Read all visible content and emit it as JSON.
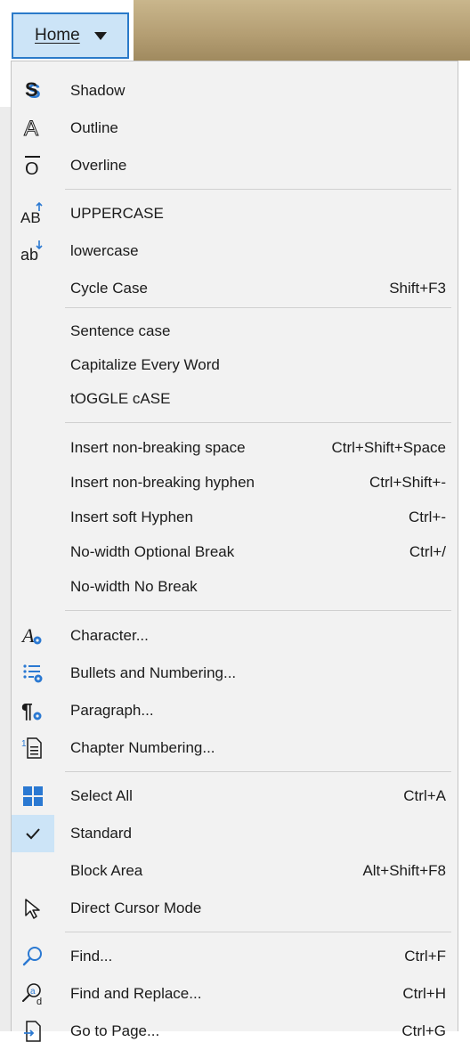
{
  "toolbar": {
    "home_label": "Home"
  },
  "menu": {
    "items": [
      {
        "label": "Shadow",
        "shortcut": "",
        "icon": "shadow-icon"
      },
      {
        "label": "Outline",
        "shortcut": "",
        "icon": "outline-icon"
      },
      {
        "label": "Overline",
        "shortcut": "",
        "icon": "overline-icon"
      },
      {
        "label": "UPPERCASE",
        "shortcut": "",
        "icon": "uppercase-icon"
      },
      {
        "label": "lowercase",
        "shortcut": "",
        "icon": "lowercase-icon"
      },
      {
        "label": "Cycle Case",
        "shortcut": "Shift+F3",
        "icon": ""
      },
      {
        "label": "Sentence case",
        "shortcut": "",
        "icon": ""
      },
      {
        "label": "Capitalize Every Word",
        "shortcut": "",
        "icon": ""
      },
      {
        "label": "tOGGLE cASE",
        "shortcut": "",
        "icon": ""
      },
      {
        "label": "Insert non-breaking space",
        "shortcut": "Ctrl+Shift+Space",
        "icon": ""
      },
      {
        "label": "Insert non-breaking hyphen",
        "shortcut": "Ctrl+Shift+-",
        "icon": ""
      },
      {
        "label": "Insert soft Hyphen",
        "shortcut": "Ctrl+-",
        "icon": ""
      },
      {
        "label": "No-width Optional Break",
        "shortcut": "Ctrl+/",
        "icon": ""
      },
      {
        "label": "No-width No Break",
        "shortcut": "",
        "icon": ""
      },
      {
        "label": "Character...",
        "shortcut": "",
        "icon": "character-icon"
      },
      {
        "label": "Bullets and Numbering...",
        "shortcut": "",
        "icon": "bullets-numbering-icon"
      },
      {
        "label": "Paragraph...",
        "shortcut": "",
        "icon": "paragraph-icon"
      },
      {
        "label": "Chapter Numbering...",
        "shortcut": "",
        "icon": "chapter-numbering-icon"
      },
      {
        "label": "Select All",
        "shortcut": "Ctrl+A",
        "icon": "select-all-icon"
      },
      {
        "label": "Standard",
        "shortcut": "",
        "icon": "checkmark-icon",
        "checked": true
      },
      {
        "label": "Block Area",
        "shortcut": "Alt+Shift+F8",
        "icon": ""
      },
      {
        "label": "Direct Cursor Mode",
        "shortcut": "",
        "icon": "direct-cursor-icon"
      },
      {
        "label": "Find...",
        "shortcut": "Ctrl+F",
        "icon": "find-icon"
      },
      {
        "label": "Find and Replace...",
        "shortcut": "Ctrl+H",
        "icon": "find-replace-icon"
      },
      {
        "label": "Go to Page...",
        "shortcut": "Ctrl+G",
        "icon": "go-to-page-icon"
      }
    ]
  },
  "colors": {
    "menu_bg": "#f2f2f2",
    "home_button_bg": "#cce4f7",
    "home_button_border": "#2a7ac9",
    "icon_blue": "#2b79d2",
    "separator": "#d0d0d0"
  }
}
